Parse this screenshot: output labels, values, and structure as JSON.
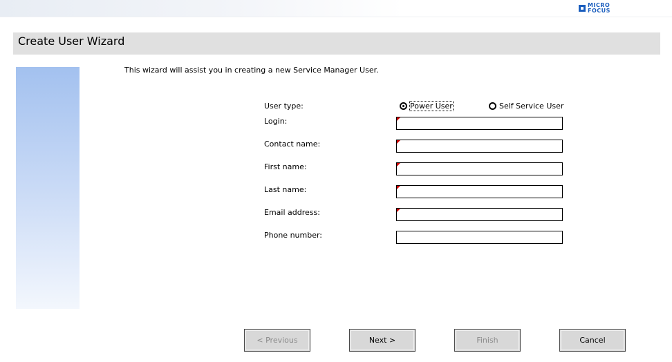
{
  "branding": {
    "logo_line1": "MICRO",
    "logo_line2": "FOCUS"
  },
  "wizard": {
    "title": "Create User Wizard",
    "intro": "This wizard will assist you in creating a new Service Manager User."
  },
  "form": {
    "user_type": {
      "label": "User type:",
      "options": [
        {
          "label": "Power User",
          "checked": true
        },
        {
          "label": "Self Service User",
          "checked": false
        }
      ]
    },
    "fields": [
      {
        "label": "Login:",
        "value": "",
        "required": true
      },
      {
        "label": "Contact name:",
        "value": "",
        "required": true
      },
      {
        "label": "First name:",
        "value": "",
        "required": true
      },
      {
        "label": "Last name:",
        "value": "",
        "required": true
      },
      {
        "label": "Email address:",
        "value": "",
        "required": true
      },
      {
        "label": "Phone number:",
        "value": "",
        "required": false
      }
    ]
  },
  "buttons": {
    "previous": "< Previous",
    "next": "Next >",
    "finish": "Finish",
    "cancel": "Cancel"
  },
  "colors": {
    "required_marker": "#d00000",
    "logo": "#1a5dbd",
    "side_panel_top": "#a3c1ef"
  }
}
